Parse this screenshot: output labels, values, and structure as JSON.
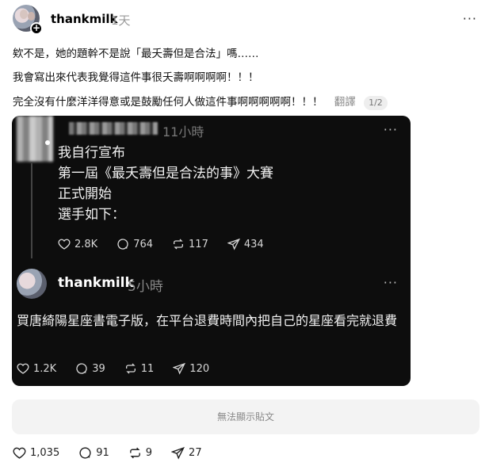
{
  "post": {
    "username": "thankmilk",
    "time": "1天",
    "more": "···",
    "line1": "欸不是，她的題幹不是說「最夭壽但是合法」嗎……",
    "line2": "我會寫出來代表我覺得這件事很夭壽啊啊啊啊！！！",
    "line3": "完全沒有什麼洋洋得意或是鼓勵任何人做這件事啊啊啊啊啊！！！",
    "translate": "翻譯",
    "pager": "1/2"
  },
  "screenshot": {
    "quoted": {
      "time": "11小時",
      "lines": [
        "我自行宣布",
        "第一屆《最夭壽但是合法的事》大賽",
        "正式開始",
        "選手如下："
      ],
      "likes": "2.8K",
      "comments": "764",
      "reposts": "117",
      "shares": "434"
    },
    "reply": {
      "username": "thankmilk",
      "time": "5小時",
      "body": "買唐綺陽星座書電子版，在平台退費時間內把自己的星座看完就退費",
      "likes": "1.2K",
      "comments": "39",
      "reposts": "11",
      "shares": "120"
    }
  },
  "unavailable": "無法顯示貼文",
  "footer": {
    "likes": "1,035",
    "comments": "91",
    "reposts": "9",
    "shares": "27"
  },
  "icons": [
    "heart-icon",
    "comment-icon",
    "repost-icon",
    "share-icon",
    "more-icon",
    "plus-icon"
  ]
}
